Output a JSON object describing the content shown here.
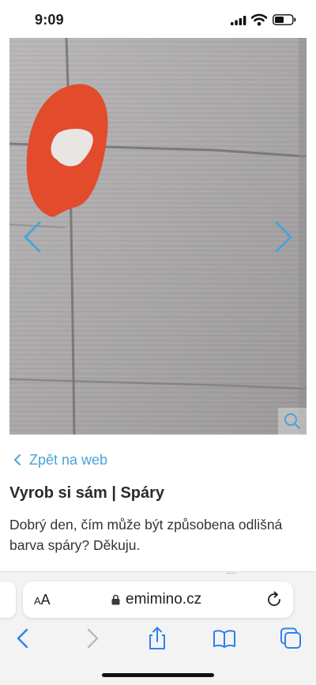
{
  "status_bar": {
    "time": "9:09",
    "icons": [
      "cellular-signal-icon",
      "wifi-icon",
      "battery-icon"
    ]
  },
  "gallery": {
    "image": "photo of light grey tiled wall with red marker circle",
    "prev_icon": "chevron-left-icon",
    "next_icon": "chevron-right-icon",
    "zoom_icon": "magnifier-icon",
    "accent_color": "#4aa3d8"
  },
  "content": {
    "back_link": "Zpět na web",
    "title": "Vyrob si sám | Spáry",
    "body": "Dobrý den, čím může být způsobena odlišná barva spáry? Děkuju."
  },
  "browser": {
    "text_size_label_small": "A",
    "text_size_label_large": "A",
    "url": "emimino.cz",
    "toolbar_icons": [
      "back-icon",
      "forward-icon",
      "share-icon",
      "bookmarks-icon",
      "tabs-icon"
    ]
  }
}
